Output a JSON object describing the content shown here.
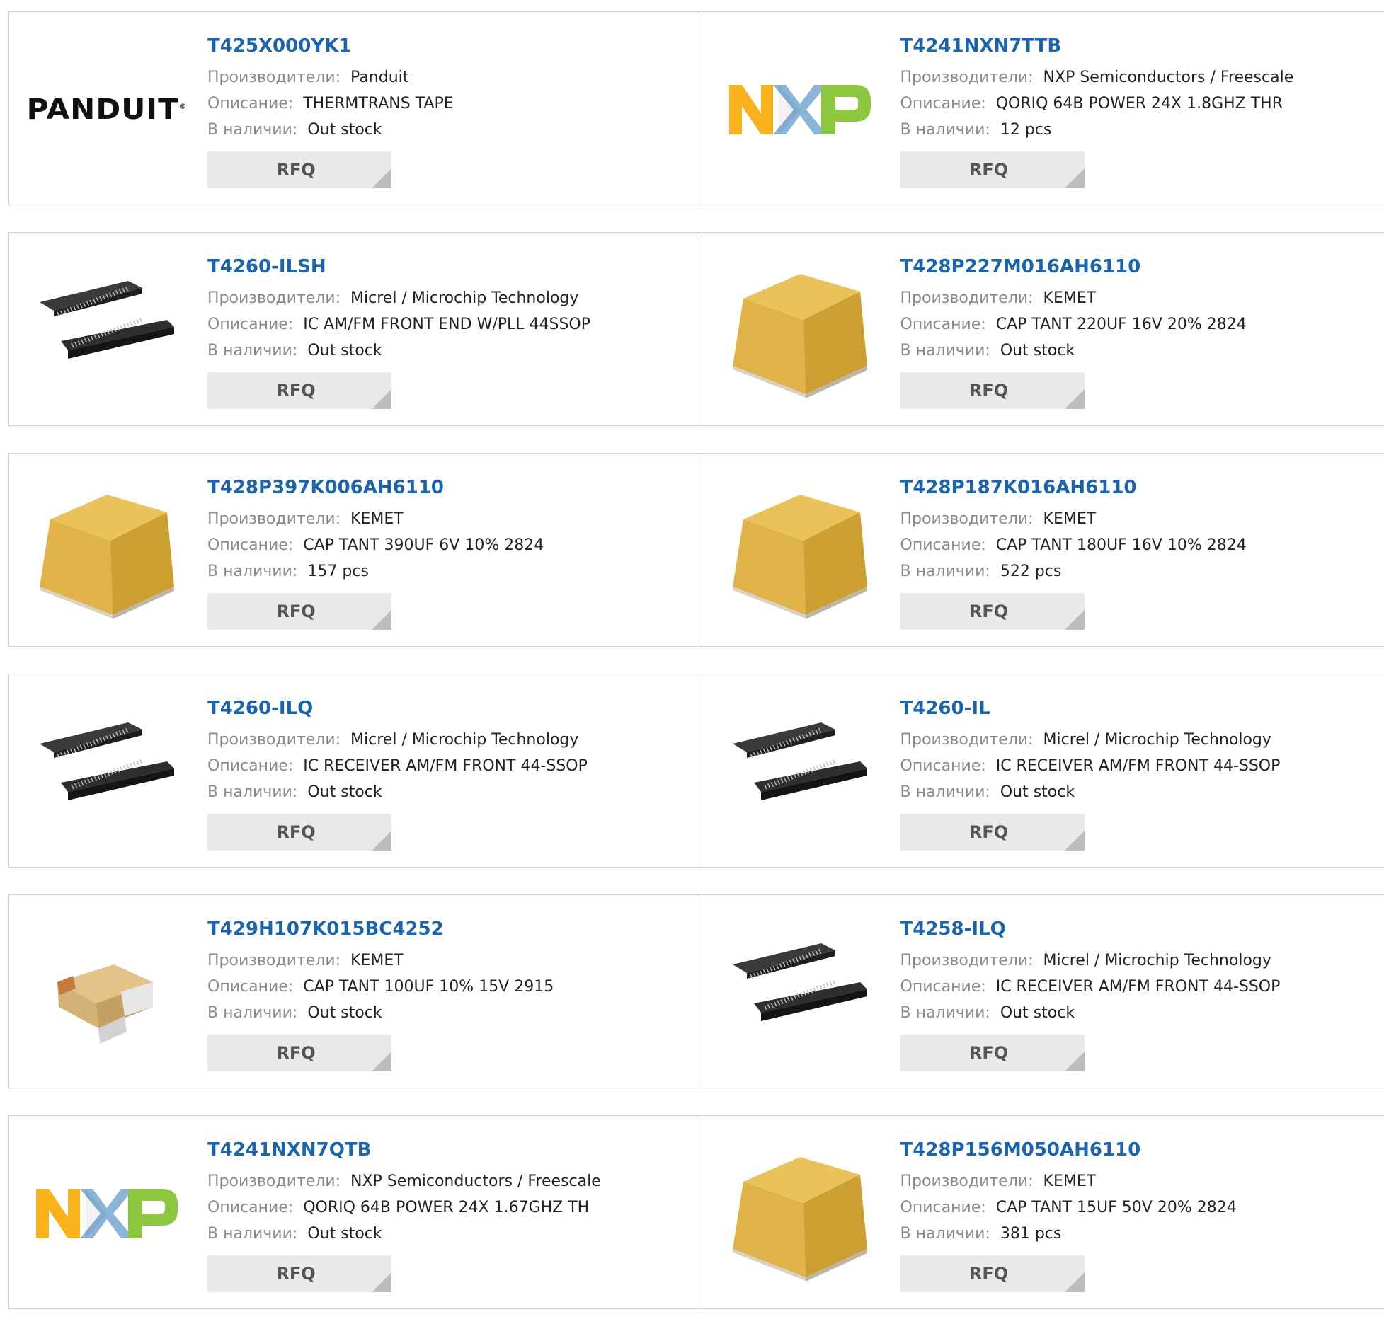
{
  "labels": {
    "manufacturer": "Производители:",
    "description": "Описание:",
    "stock": "В наличии:",
    "rfq": "RFQ"
  },
  "products": [
    {
      "part": "T425X000YK1",
      "manufacturer": "Panduit",
      "description": "THERMTRANS TAPE",
      "stock": "Out stock",
      "image": "panduit-logo"
    },
    {
      "part": "T4241NXN7TTB",
      "manufacturer": "NXP Semiconductors / Freescale",
      "description": "QORIQ 64B POWER 24X 1.8GHZ THR",
      "stock": "12 pcs",
      "image": "nxp-logo"
    },
    {
      "part": "T4260-ILSH",
      "manufacturer": "Micrel / Microchip Technology",
      "description": "IC AM/FM FRONT END W/PLL 44SSOP",
      "stock": "Out stock",
      "image": "ssop-chip"
    },
    {
      "part": "T428P227M016AH6110",
      "manufacturer": "KEMET",
      "description": "CAP TANT 220UF 16V 20% 2824",
      "stock": "Out stock",
      "image": "tantalum-block"
    },
    {
      "part": "T428P397K006AH6110",
      "manufacturer": "KEMET",
      "description": "CAP TANT 390UF 6V 10% 2824",
      "stock": "157 pcs",
      "image": "tantalum-block"
    },
    {
      "part": "T428P187K016AH6110",
      "manufacturer": "KEMET",
      "description": "CAP TANT 180UF 16V 10% 2824",
      "stock": "522 pcs",
      "image": "tantalum-block"
    },
    {
      "part": "T4260-ILQ",
      "manufacturer": "Micrel / Microchip Technology",
      "description": "IC RECEIVER AM/FM FRONT 44-SSOP",
      "stock": "Out stock",
      "image": "ssop-chip"
    },
    {
      "part": "T4260-IL",
      "manufacturer": "Micrel / Microchip Technology",
      "description": "IC RECEIVER AM/FM FRONT 44-SSOP",
      "stock": "Out stock",
      "image": "ssop-chip"
    },
    {
      "part": "T429H107K015BC4252",
      "manufacturer": "KEMET",
      "description": "CAP TANT 100UF 10% 15V 2915",
      "stock": "Out stock",
      "image": "smd-capacitor"
    },
    {
      "part": "T4258-ILQ",
      "manufacturer": "Micrel / Microchip Technology",
      "description": "IC RECEIVER AM/FM FRONT 44-SSOP",
      "stock": "Out stock",
      "image": "ssop-chip"
    },
    {
      "part": "T4241NXN7QTB",
      "manufacturer": "NXP Semiconductors / Freescale",
      "description": "QORIQ 64B POWER 24X 1.67GHZ TH",
      "stock": "Out stock",
      "image": "nxp-logo"
    },
    {
      "part": "T428P156M050AH6110",
      "manufacturer": "KEMET",
      "description": "CAP TANT 15UF 50V 20% 2824",
      "stock": "381 pcs",
      "image": "tantalum-block"
    }
  ],
  "logo_text": {
    "panduit": "PANDUIT"
  },
  "colors": {
    "part_link": "#1a63ad",
    "nxp_orange": "#f9b21b",
    "nxp_blue": "#8ab4d8",
    "nxp_green": "#8dc63f"
  }
}
